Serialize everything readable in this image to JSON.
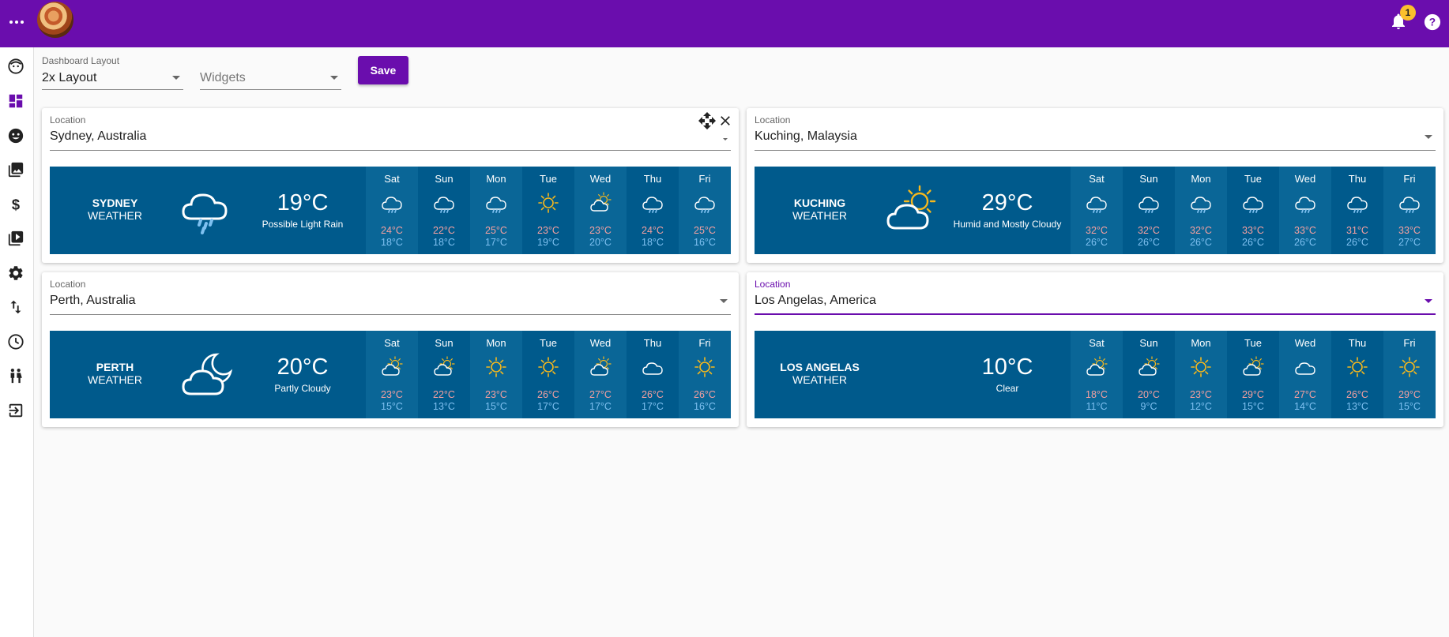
{
  "notifications": {
    "count": "1"
  },
  "toolbar": {
    "layout_label": "Dashboard Layout",
    "layout_value": "2x Layout",
    "widgets_placeholder": "Widgets",
    "save_label": "Save"
  },
  "colors": {
    "brand": "#6a0dad",
    "weather_bg": "#005a8c",
    "high_temp": "#f4a0a0",
    "low_temp": "#7ec0f0",
    "sun": "#f6b81c"
  },
  "widgets": [
    {
      "location_label": "Location",
      "location": "Sydney, Australia",
      "city": "SYDNEY",
      "suffix": "WEATHER",
      "temp": "19°C",
      "desc": "Possible Light Rain",
      "icon": "rain-cloud-icon",
      "days": [
        {
          "name": "Sat",
          "icon": "rain-icon",
          "hi": "24°C",
          "lo": "18°C"
        },
        {
          "name": "Sun",
          "icon": "rain-icon",
          "hi": "22°C",
          "lo": "18°C"
        },
        {
          "name": "Mon",
          "icon": "rain-icon",
          "hi": "25°C",
          "lo": "17°C"
        },
        {
          "name": "Tue",
          "icon": "sun-icon",
          "hi": "23°C",
          "lo": "19°C"
        },
        {
          "name": "Wed",
          "icon": "partly-cloudy-icon",
          "hi": "23°C",
          "lo": "20°C"
        },
        {
          "name": "Thu",
          "icon": "rain-icon",
          "hi": "24°C",
          "lo": "18°C"
        },
        {
          "name": "Fri",
          "icon": "rain-icon",
          "hi": "25°C",
          "lo": "16°C"
        }
      ]
    },
    {
      "location_label": "Location",
      "location": "Kuching, Malaysia",
      "city": "KUCHING",
      "suffix": "WEATHER",
      "temp": "29°C",
      "desc": "Humid and Mostly Cloudy",
      "icon": "sun-cloud-icon",
      "days": [
        {
          "name": "Sat",
          "icon": "rain-icon",
          "hi": "32°C",
          "lo": "26°C"
        },
        {
          "name": "Sun",
          "icon": "rain-icon",
          "hi": "32°C",
          "lo": "26°C"
        },
        {
          "name": "Mon",
          "icon": "rain-icon",
          "hi": "32°C",
          "lo": "26°C"
        },
        {
          "name": "Tue",
          "icon": "rain-icon",
          "hi": "33°C",
          "lo": "26°C"
        },
        {
          "name": "Wed",
          "icon": "rain-icon",
          "hi": "33°C",
          "lo": "26°C"
        },
        {
          "name": "Thu",
          "icon": "rain-icon",
          "hi": "31°C",
          "lo": "26°C"
        },
        {
          "name": "Fri",
          "icon": "rain-icon",
          "hi": "33°C",
          "lo": "27°C"
        }
      ]
    },
    {
      "location_label": "Location",
      "location": "Perth, Australia",
      "city": "PERTH",
      "suffix": "WEATHER",
      "temp": "20°C",
      "desc": "Partly Cloudy",
      "icon": "moon-cloud-icon",
      "days": [
        {
          "name": "Sat",
          "icon": "partly-cloudy-icon",
          "hi": "23°C",
          "lo": "15°C"
        },
        {
          "name": "Sun",
          "icon": "partly-cloudy-icon",
          "hi": "22°C",
          "lo": "13°C"
        },
        {
          "name": "Mon",
          "icon": "sun-icon",
          "hi": "23°C",
          "lo": "15°C"
        },
        {
          "name": "Tue",
          "icon": "sun-icon",
          "hi": "26°C",
          "lo": "17°C"
        },
        {
          "name": "Wed",
          "icon": "partly-cloudy-icon",
          "hi": "27°C",
          "lo": "17°C"
        },
        {
          "name": "Thu",
          "icon": "cloud-icon",
          "hi": "26°C",
          "lo": "17°C"
        },
        {
          "name": "Fri",
          "icon": "sun-icon",
          "hi": "26°C",
          "lo": "16°C"
        }
      ]
    },
    {
      "location_label": "Location",
      "location": "Los Angelas, America",
      "city": "LOS ANGELAS",
      "suffix": "WEATHER",
      "temp": "10°C",
      "desc": "Clear",
      "icon": "moon-icon",
      "days": [
        {
          "name": "Sat",
          "icon": "partly-cloudy-icon",
          "hi": "18°C",
          "lo": "11°C"
        },
        {
          "name": "Sun",
          "icon": "partly-cloudy-icon",
          "hi": "20°C",
          "lo": "9°C"
        },
        {
          "name": "Mon",
          "icon": "sun-icon",
          "hi": "23°C",
          "lo": "12°C"
        },
        {
          "name": "Tue",
          "icon": "partly-cloudy-icon",
          "hi": "29°C",
          "lo": "15°C"
        },
        {
          "name": "Wed",
          "icon": "cloud-icon",
          "hi": "27°C",
          "lo": "14°C"
        },
        {
          "name": "Thu",
          "icon": "sun-icon",
          "hi": "26°C",
          "lo": "13°C"
        },
        {
          "name": "Fri",
          "icon": "sun-icon",
          "hi": "29°C",
          "lo": "15°C"
        }
      ]
    }
  ]
}
